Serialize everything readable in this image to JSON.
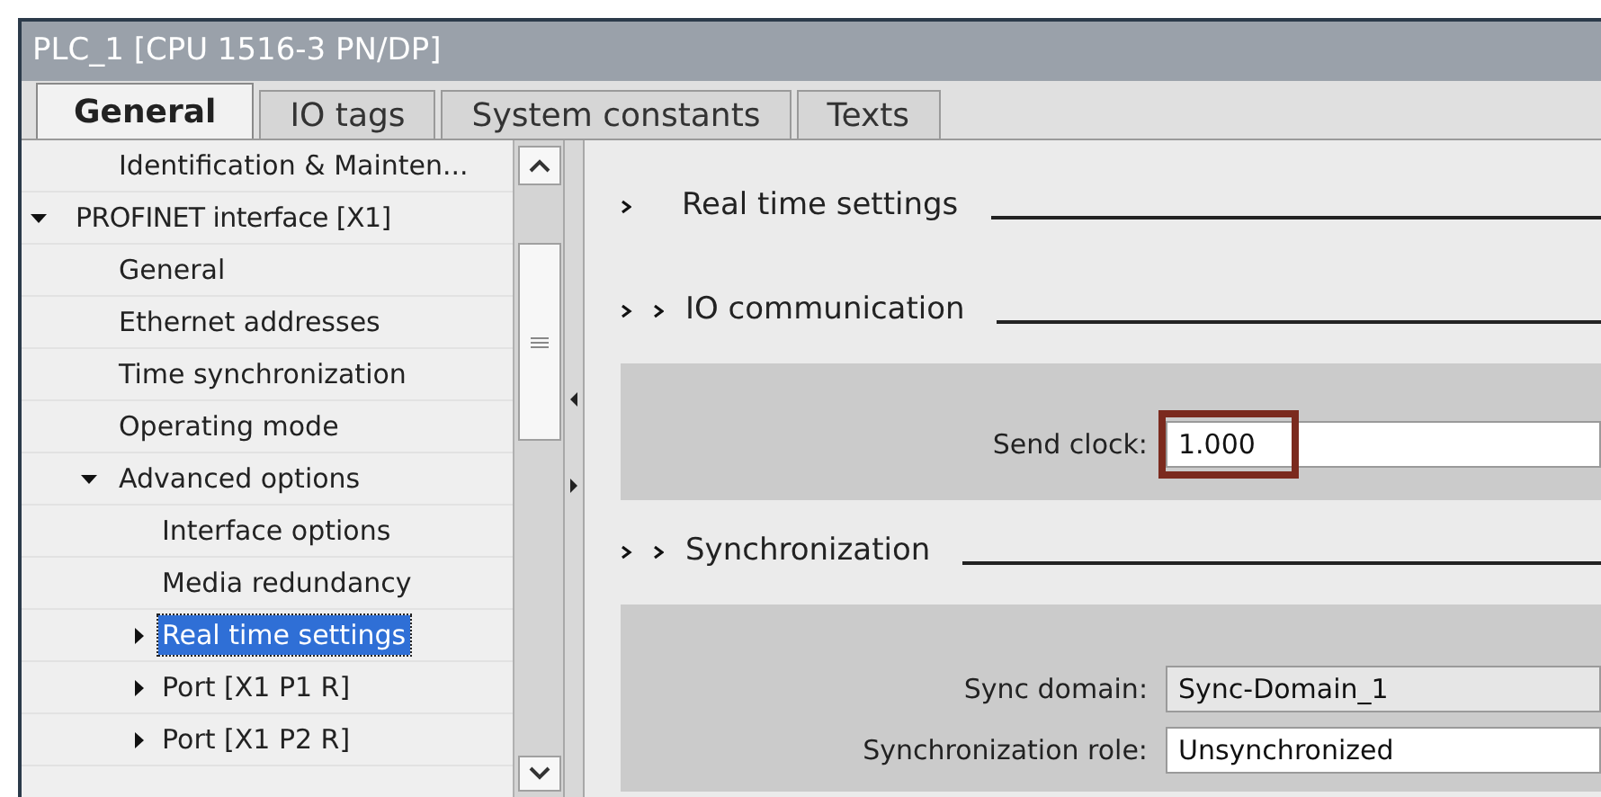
{
  "window": {
    "title": "PLC_1 [CPU 1516-3 PN/DP]"
  },
  "tabs": [
    {
      "label": "General",
      "selected": true
    },
    {
      "label": "IO tags",
      "selected": false
    },
    {
      "label": "System constants",
      "selected": false
    },
    {
      "label": "Texts",
      "selected": false
    }
  ],
  "tree": [
    {
      "label": "Identification & Mainten...",
      "selected": false
    },
    {
      "label": "PROFINET interface [X1]",
      "expanded": true,
      "selected": false,
      "children": [
        {
          "label": "General",
          "selected": false
        },
        {
          "label": "Ethernet addresses",
          "selected": false
        },
        {
          "label": "Time synchronization",
          "selected": false
        },
        {
          "label": "Operating mode",
          "selected": false
        },
        {
          "label": "Advanced options",
          "expanded": true,
          "selected": false,
          "children": [
            {
              "label": "Interface options",
              "selected": false
            },
            {
              "label": "Media redundancy",
              "selected": false
            },
            {
              "label": "Real time settings",
              "expanded": false,
              "selected": true
            },
            {
              "label": "Port [X1 P1 R]",
              "expanded": false,
              "selected": false
            },
            {
              "label": "Port [X1 P2 R]",
              "expanded": false,
              "selected": false
            }
          ]
        }
      ]
    }
  ],
  "section": {
    "title": "Real time settings",
    "children": [
      {
        "title": "IO communication",
        "fields": [
          {
            "label": "Send clock:",
            "value": "1.000",
            "highlighted": true,
            "editable": true
          }
        ]
      },
      {
        "title": "Synchronization",
        "fields": [
          {
            "label": "Sync domain:",
            "value": "Sync-Domain_1",
            "highlighted": false,
            "editable": false
          },
          {
            "label": "Synchronization role:",
            "value": "Unsynchronized",
            "highlighted": false,
            "editable": true
          }
        ]
      }
    ]
  }
}
